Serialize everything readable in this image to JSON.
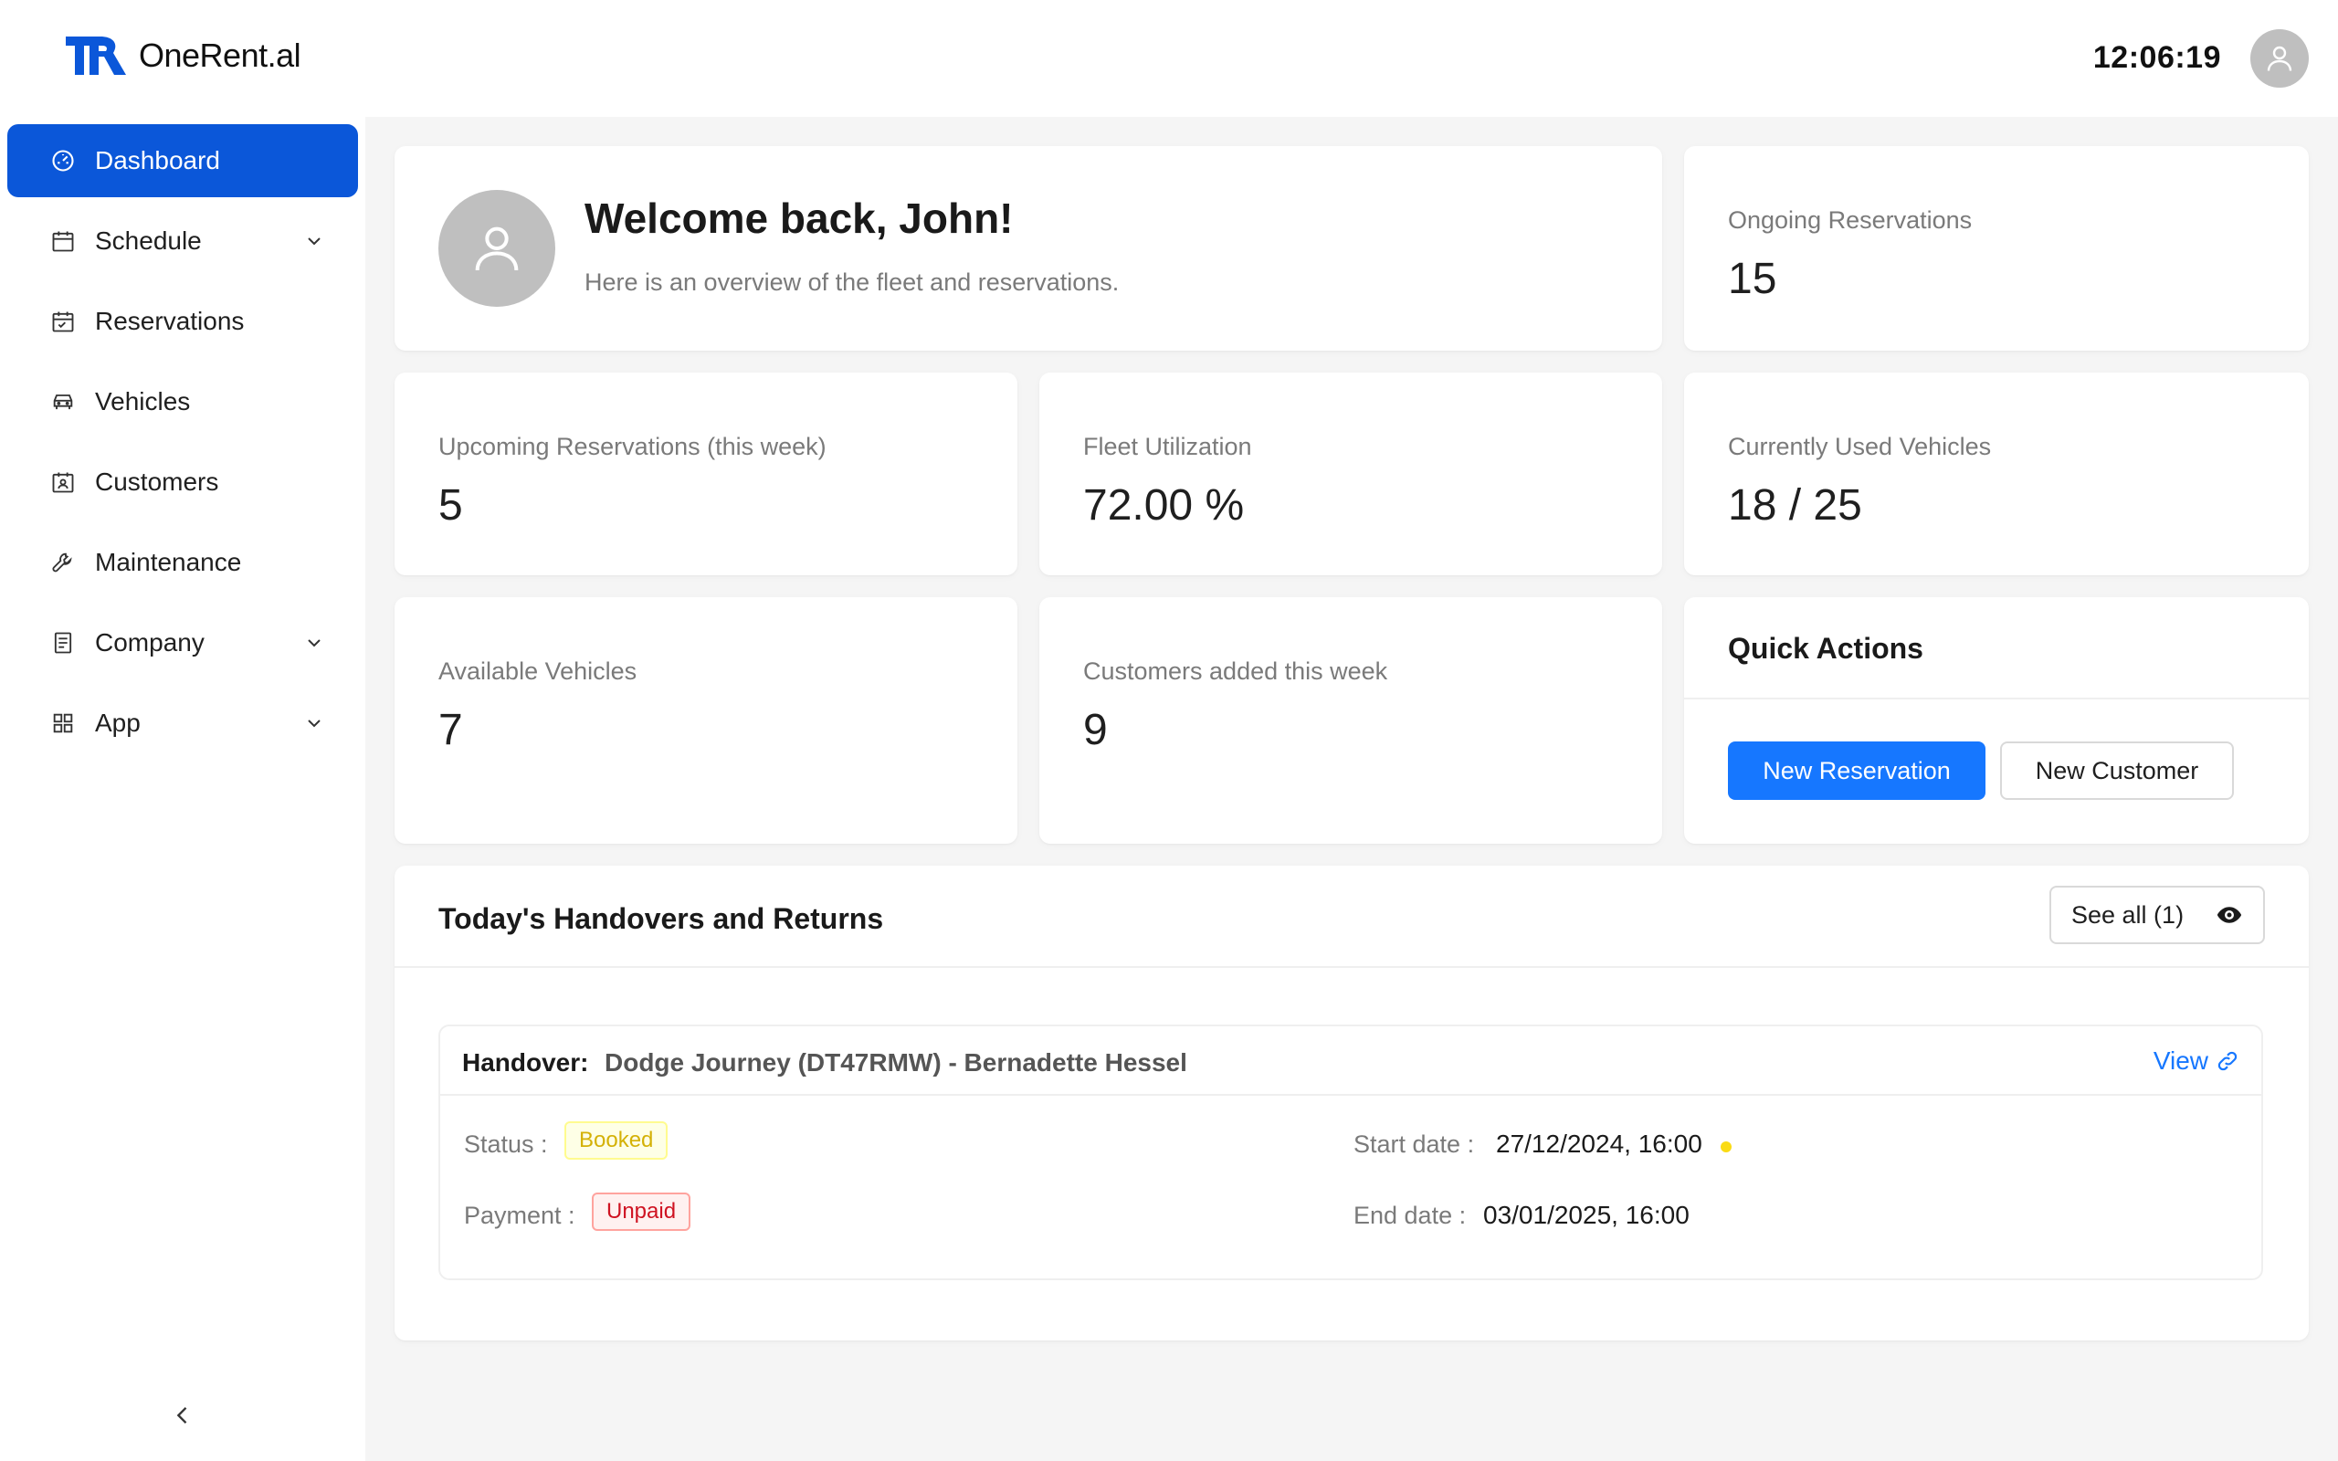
{
  "brand": {
    "name": "OneRent.al",
    "accent": "#0b57d9"
  },
  "header": {
    "clock": "12:06:19",
    "avatar_icon": "user-icon"
  },
  "sidebar": {
    "items": [
      {
        "label": "Dashboard",
        "icon": "dashboard-icon",
        "active": true
      },
      {
        "label": "Schedule",
        "icon": "calendar-icon",
        "has_submenu": true
      },
      {
        "label": "Reservations",
        "icon": "calendar-check-icon"
      },
      {
        "label": "Vehicles",
        "icon": "car-icon"
      },
      {
        "label": "Customers",
        "icon": "contact-card-icon"
      },
      {
        "label": "Maintenance",
        "icon": "wrench-icon"
      },
      {
        "label": "Company",
        "icon": "document-icon",
        "has_submenu": true
      },
      {
        "label": "App",
        "icon": "grid-icon",
        "has_submenu": true
      }
    ],
    "collapse_icon": "chevron-left-icon"
  },
  "welcome": {
    "title": "Welcome back, John!",
    "subtitle": "Here is an overview of the fleet and reservations."
  },
  "stats": {
    "ongoing": {
      "label": "Ongoing Reservations",
      "value": "15"
    },
    "upcoming": {
      "label": "Upcoming Reservations (this week)",
      "value": "5"
    },
    "utilization": {
      "label": "Fleet Utilization",
      "value": "72.00 %"
    },
    "used": {
      "label": "Currently Used Vehicles",
      "value": "18 / 25"
    },
    "available": {
      "label": "Available Vehicles",
      "value": "7"
    },
    "customers": {
      "label": "Customers added this week",
      "value": "9"
    }
  },
  "quick_actions": {
    "title": "Quick Actions",
    "new_reservation": "New Reservation",
    "new_customer": "New Customer"
  },
  "handovers": {
    "title": "Today's Handovers and Returns",
    "see_all": "See all (1)",
    "item": {
      "type_label": "Handover:",
      "description": "Dodge Journey (DT47RMW) - Bernadette Hessel",
      "view": "View",
      "status_label": "Status :",
      "status": "Booked",
      "payment_label": "Payment :",
      "payment": "Unpaid",
      "start_label": "Start date :",
      "start": "27/12/2024, 16:00",
      "end_label": "End date :",
      "end": "03/01/2025, 16:00"
    }
  }
}
